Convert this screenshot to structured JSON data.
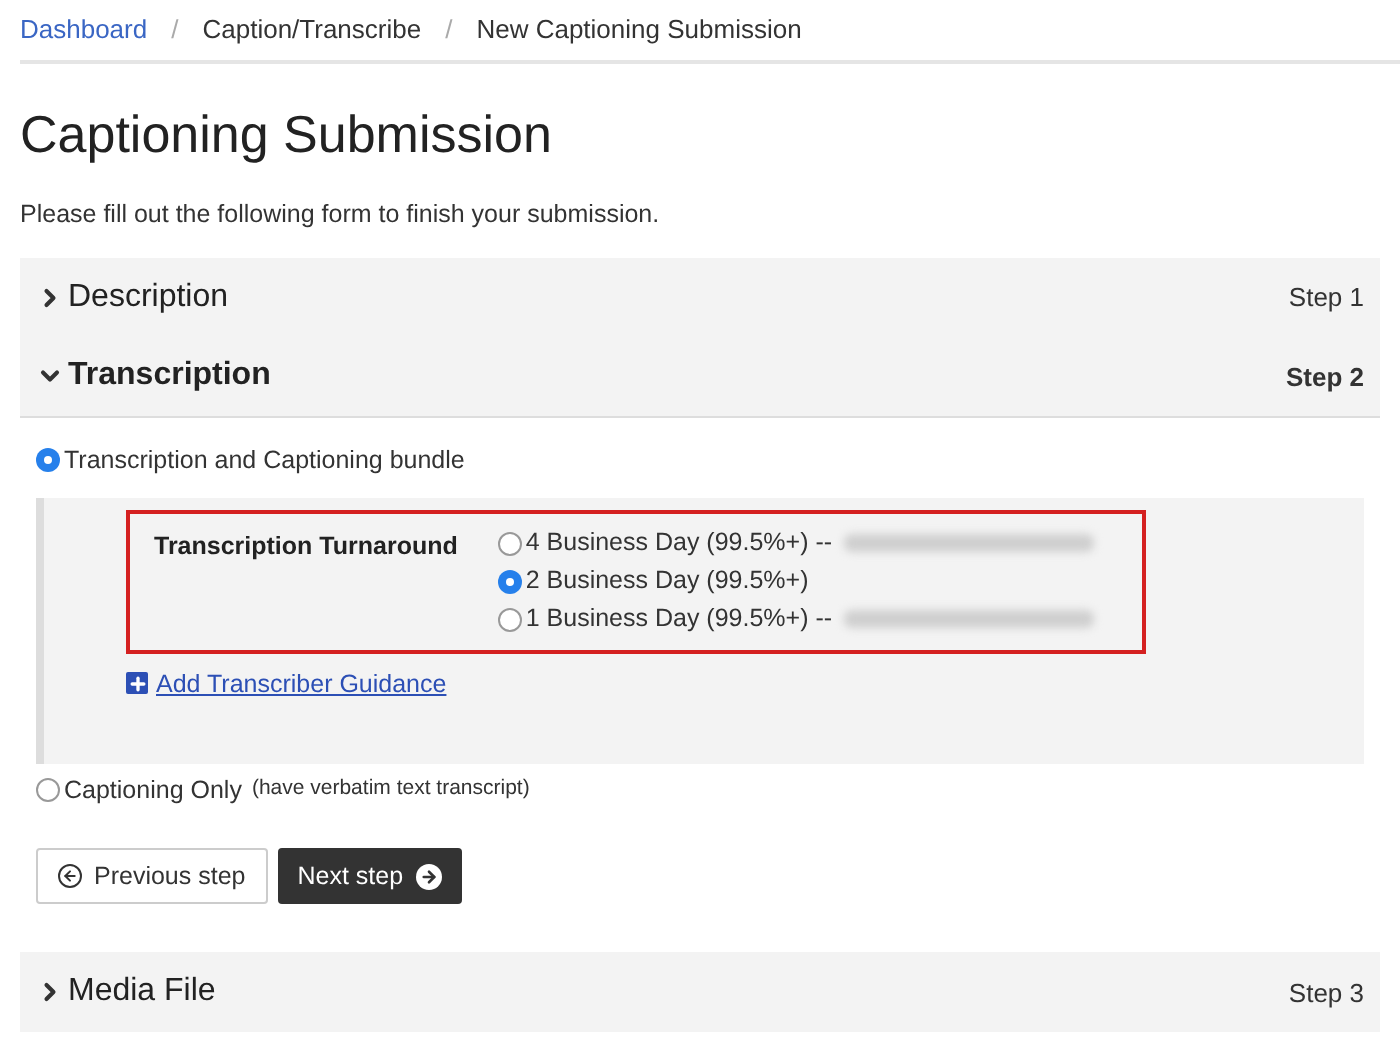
{
  "breadcrumb": [
    {
      "label": "Dashboard",
      "kind": "link"
    },
    {
      "label": "Caption/Transcribe",
      "kind": "text"
    },
    {
      "label": "New Captioning Submission",
      "kind": "text"
    }
  ],
  "breadcrumb_separator": "/",
  "title": "Captioning Submission",
  "intro": "Please fill out the following form to finish your submission.",
  "steps": [
    {
      "title": "Description",
      "step": "Step 1",
      "expanded": false
    },
    {
      "title": "Transcription",
      "step": "Step 2",
      "expanded": true
    },
    {
      "title": "Media File",
      "step": "Step 3",
      "expanded": false
    }
  ],
  "service_options": [
    {
      "label": "Transcription and Captioning bundle",
      "selected": true
    },
    {
      "label": "Captioning Only",
      "note": "(have verbatim text transcript)",
      "selected": false
    }
  ],
  "turnaround": {
    "label": "Transcription Turnaround",
    "options": [
      {
        "label": "4 Business Day (99.5%+) --",
        "redacted": true,
        "selected": false
      },
      {
        "label": "2 Business Day (99.5%+)",
        "redacted": false,
        "selected": true
      },
      {
        "label": "1 Business Day (99.5%+) --",
        "redacted": true,
        "selected": false
      }
    ]
  },
  "guidance_link": "Add Transcriber Guidance",
  "buttons": {
    "previous": "Previous step",
    "next": "Next step"
  }
}
